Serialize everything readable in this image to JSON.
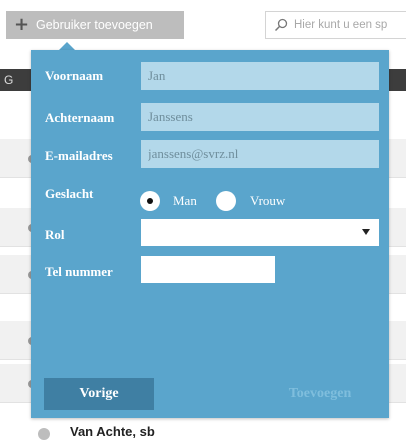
{
  "toolbar": {
    "add_user_label": "Gebruiker toevoegen"
  },
  "search": {
    "placeholder": "Hier kunt u een sp"
  },
  "background": {
    "header_letter": "G",
    "bottom_item_name": "Van Achte, sb"
  },
  "form": {
    "first_name": {
      "label": "Voornaam",
      "value": "Jan"
    },
    "last_name": {
      "label": "Achternaam",
      "value": "Janssens"
    },
    "email": {
      "label": "E-mailadres",
      "value": "janssens@svrz.nl"
    },
    "gender": {
      "label": "Geslacht",
      "options": [
        "Man",
        "Vrouw"
      ],
      "selected": "Man"
    },
    "role": {
      "label": "Rol",
      "value": ""
    },
    "phone": {
      "label": "Tel nummer",
      "value": ""
    },
    "prev_label": "Vorige",
    "submit_label": "Toevoegen"
  },
  "colors": {
    "dialog": "#5aa5cc",
    "input": "#b3d8ea",
    "button": "#3f7fa3",
    "dark_bar": "#3d3d3d"
  }
}
